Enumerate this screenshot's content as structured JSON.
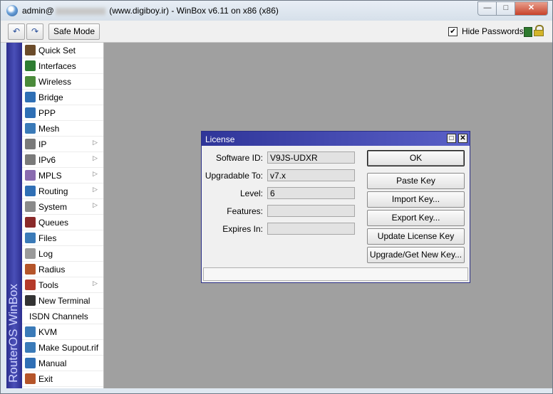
{
  "window": {
    "title_prefix": "admin@",
    "title_suffix": "(www.digiboy.ir) - WinBox v6.11 on x86 (x86)",
    "min_glyph": "—",
    "max_glyph": "□",
    "close_glyph": "✕"
  },
  "toolbar": {
    "undo_glyph": "↶",
    "redo_glyph": "↷",
    "safe_mode_label": "Safe Mode",
    "hide_passwords_label": "Hide Passwords",
    "hide_passwords_checked": "✔",
    "status_color": "#2e7a2e"
  },
  "brand": {
    "vertical_text": "RouterOS WinBox",
    "color": "#2c2f8f"
  },
  "sidebar": {
    "items": [
      {
        "label": "Quick Set",
        "icon": "quick-set-icon",
        "color": "#6b4b2a",
        "arrow": ""
      },
      {
        "label": "Interfaces",
        "icon": "interfaces-icon",
        "color": "#2e7d32",
        "arrow": ""
      },
      {
        "label": "Wireless",
        "icon": "wireless-icon",
        "color": "#4a8a3a",
        "arrow": ""
      },
      {
        "label": "Bridge",
        "icon": "bridge-icon",
        "color": "#2f6fb5",
        "arrow": ""
      },
      {
        "label": "PPP",
        "icon": "ppp-icon",
        "color": "#2f6fb5",
        "arrow": ""
      },
      {
        "label": "Mesh",
        "icon": "mesh-icon",
        "color": "#3a7ab8",
        "arrow": ""
      },
      {
        "label": "IP",
        "icon": "ip-icon",
        "color": "#7a7a7a",
        "arrow": "▷"
      },
      {
        "label": "IPv6",
        "icon": "ipv6-icon",
        "color": "#7a7a7a",
        "arrow": "▷"
      },
      {
        "label": "MPLS",
        "icon": "mpls-icon",
        "color": "#8a6bb0",
        "arrow": "▷"
      },
      {
        "label": "Routing",
        "icon": "routing-icon",
        "color": "#2f6fb5",
        "arrow": "▷"
      },
      {
        "label": "System",
        "icon": "system-icon",
        "color": "#8a8a8a",
        "arrow": "▷"
      },
      {
        "label": "Queues",
        "icon": "queues-icon",
        "color": "#8a2a2a",
        "arrow": ""
      },
      {
        "label": "Files",
        "icon": "files-icon",
        "color": "#3a7ab8",
        "arrow": ""
      },
      {
        "label": "Log",
        "icon": "log-icon",
        "color": "#9a9a9a",
        "arrow": ""
      },
      {
        "label": "Radius",
        "icon": "radius-icon",
        "color": "#b5552a",
        "arrow": ""
      },
      {
        "label": "Tools",
        "icon": "tools-icon",
        "color": "#b53a2a",
        "arrow": "▷"
      },
      {
        "label": "New Terminal",
        "icon": "terminal-icon",
        "color": "#333333",
        "arrow": ""
      },
      {
        "label": "ISDN Channels",
        "icon": "",
        "color": "",
        "arrow": ""
      },
      {
        "label": "KVM",
        "icon": "kvm-icon",
        "color": "#3a7ab8",
        "arrow": ""
      },
      {
        "label": "Make Supout.rif",
        "icon": "supout-icon",
        "color": "#3a7ab8",
        "arrow": ""
      },
      {
        "label": "Manual",
        "icon": "manual-icon",
        "color": "#2f6fb5",
        "arrow": ""
      },
      {
        "label": "Exit",
        "icon": "exit-icon",
        "color": "#b5552a",
        "arrow": ""
      }
    ]
  },
  "dialog": {
    "title": "License",
    "max_glyph": "□",
    "close_glyph": "✕",
    "fields": [
      {
        "label": "Software ID:",
        "value": "V9JS-UDXR"
      },
      {
        "label": "Upgradable To:",
        "value": "v7.x"
      },
      {
        "label": "Level:",
        "value": "6"
      },
      {
        "label": "Features:",
        "value": ""
      },
      {
        "label": "Expires In:",
        "value": ""
      }
    ],
    "buttons": {
      "ok": "OK",
      "paste_key": "Paste Key",
      "import_key": "Import Key...",
      "export_key": "Export Key...",
      "update_license_key": "Update License Key",
      "upgrade_get_new_key": "Upgrade/Get New Key..."
    },
    "title_color": "#2f3599"
  }
}
